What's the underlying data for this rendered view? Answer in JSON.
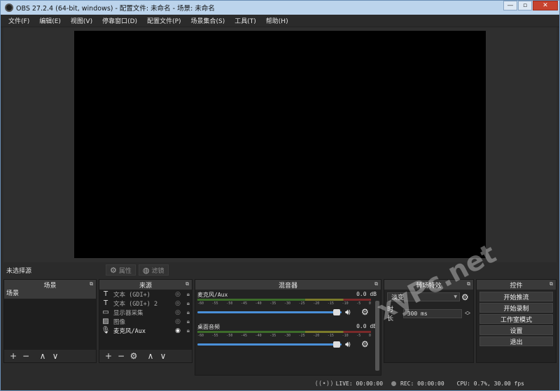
{
  "window": {
    "title": "OBS 27.2.4 (64-bit, windows) - 配置文件: 未命名 - 场景: 未命名"
  },
  "menu": [
    "文件(F)",
    "编辑(E)",
    "视图(V)",
    "停靠窗口(D)",
    "配置文件(P)",
    "场景集合(S)",
    "工具(T)",
    "帮助(H)"
  ],
  "source_toolbar": {
    "no_source": "未选择源",
    "properties": "属性",
    "filters": "滤镜"
  },
  "scenes": {
    "title": "场景",
    "items": [
      "场景"
    ]
  },
  "sources": {
    "title": "来源",
    "items": [
      {
        "icon": "T",
        "label": "文本 (GDI+)",
        "active": false
      },
      {
        "icon": "T",
        "label": "文本 (GDI+) 2",
        "active": false
      },
      {
        "icon": "▭",
        "label": "显示器采集",
        "active": false
      },
      {
        "icon": "▨",
        "label": "图像",
        "active": false
      },
      {
        "icon": "🎙",
        "label": "麦克风/Aux",
        "active": true
      }
    ]
  },
  "mixer": {
    "title": "混音器",
    "ticks": [
      "-60",
      "-55",
      "-50",
      "-45",
      "-40",
      "-35",
      "-30",
      "-25",
      "-20",
      "-15",
      "-10",
      "-5",
      "0"
    ],
    "tracks": [
      {
        "name": "麦克风/Aux",
        "db": "0.0 dB"
      },
      {
        "name": "桌面音频",
        "db": "0.0 dB"
      }
    ]
  },
  "transitions": {
    "title": "转场特效",
    "selected": "淡变",
    "duration_label": "时长",
    "duration": "300 ms"
  },
  "controls": {
    "title": "控件",
    "buttons": [
      "开始推流",
      "开始录制",
      "工作室模式",
      "设置",
      "退出"
    ]
  },
  "status": {
    "live": "LIVE: 00:00:00",
    "rec": "REC: 00:00:00",
    "cpu": "CPU: 0.7%, 30.00 fps"
  },
  "watermark": "xyPc.net"
}
